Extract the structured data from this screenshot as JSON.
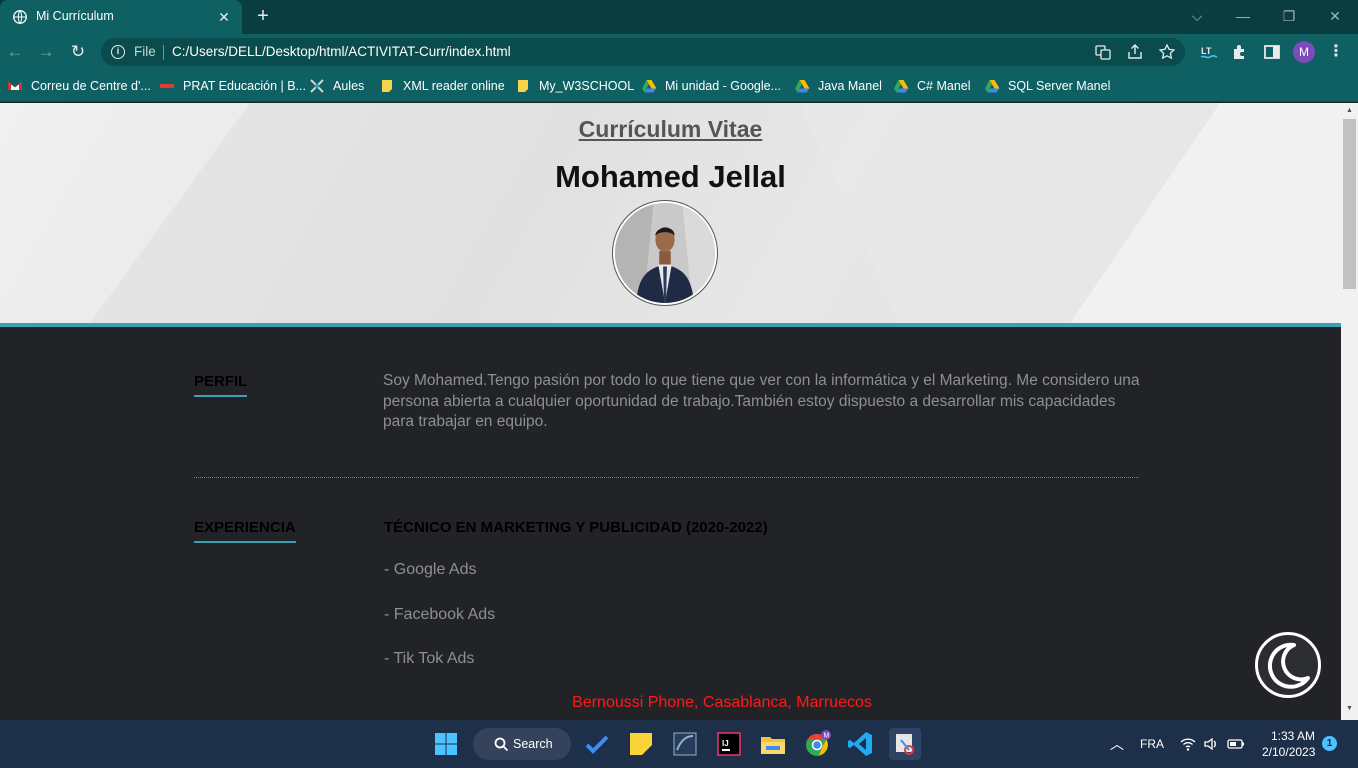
{
  "browser": {
    "tab": {
      "title": "Mi Currículum",
      "close": "✕"
    },
    "new_tab": "+",
    "window_controls": [
      "⌵",
      "—",
      "❐",
      "✕"
    ],
    "nav": {
      "back": "←",
      "forward": "→",
      "reload": "↻"
    },
    "omnibox": {
      "scheme_label": "File",
      "url": "C:/Users/DELL/Desktop/html/ACTIVITAT-Curr/index.html"
    },
    "profile_initial": "M",
    "bookmarks": [
      {
        "label": "Correu de Centre d'...",
        "icon": "gmail-icon"
      },
      {
        "label": "PRAT Educación | B...",
        "icon": "prat-icon"
      },
      {
        "label": "Aules",
        "icon": "aules-icon"
      },
      {
        "label": "XML reader online",
        "icon": "note-icon"
      },
      {
        "label": "My_W3SCHOOL",
        "icon": "note-icon"
      },
      {
        "label": "Mi unidad - Google...",
        "icon": "drive-icon"
      },
      {
        "label": "Java Manel",
        "icon": "drive-icon"
      },
      {
        "label": "C# Manel",
        "icon": "drive-icon"
      },
      {
        "label": "SQL Server Manel",
        "icon": "drive-icon"
      }
    ]
  },
  "page": {
    "title": "Currículum Vitae",
    "name": "Mohamed Jellal",
    "profile": {
      "heading": "PERFIL",
      "text": "Soy Mohamed.Tengo pasión por todo lo que tiene que ver con la informática y el Marketing. Me considero una persona abierta a cualquier oportunidad de trabajo.También estoy dispuesto a desarrollar mis capacidades para trabajar en equipo."
    },
    "experience": {
      "heading": "EXPERIENCIA",
      "job_title": "TÉCNICO EN MARKETING Y PUBLICIDAD (2020-2022)",
      "duties": [
        "- Google Ads",
        "- Facebook Ads",
        "- Tik Tok Ads"
      ]
    },
    "address": "Bernoussi Phone, Casablanca, Marruecos"
  },
  "taskbar": {
    "search_label": "Search",
    "language": "FRA",
    "time": "1:33 AM",
    "date": "2/10/2023",
    "notification_count": "1"
  },
  "colors": {
    "accent": "#3aa0b6",
    "browser_frame": "#0f6063",
    "page_background": "#222327",
    "address_text": "#ff1a1a"
  }
}
